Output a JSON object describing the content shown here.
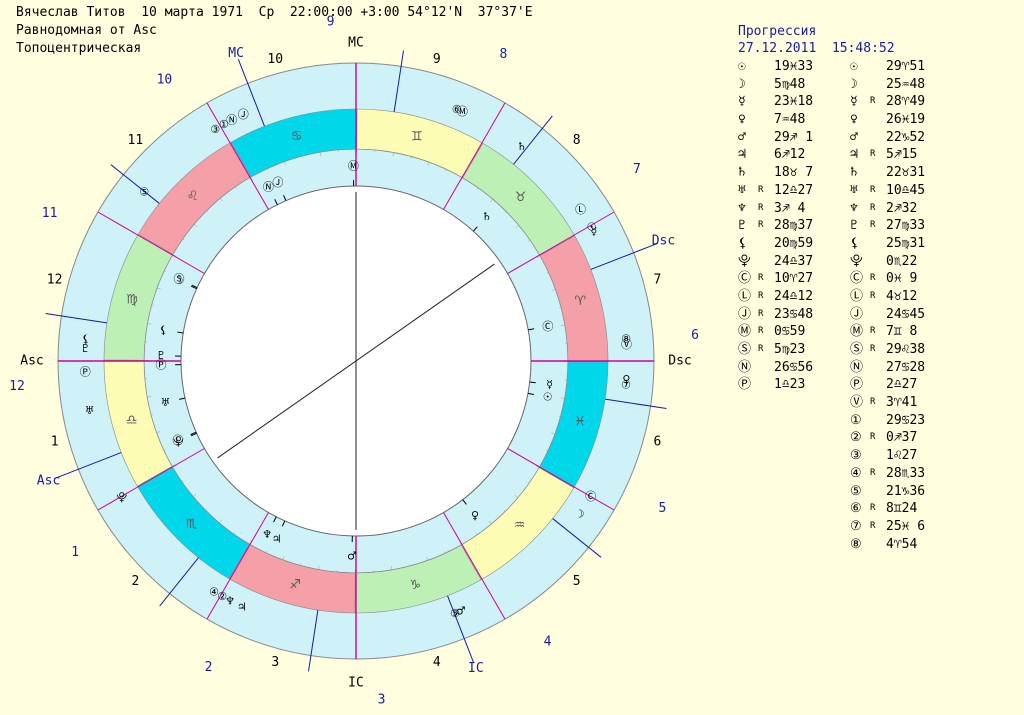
{
  "header": {
    "line1": "Вячеслав Титов  10 марта 1971  Ср  22:00:00 +3:00 54°12'N  37°37'E",
    "line2": "Равнодомная от Asc",
    "line3": "Топоцентрическая"
  },
  "chart_labels": {
    "asc": "Asc",
    "dsc": "Dsc",
    "mc": "MC",
    "ic": "IC",
    "inner_houses": [
      "1",
      "2",
      "3",
      "4",
      "5",
      "6",
      "7",
      "8",
      "9",
      "10",
      "11",
      "12"
    ],
    "outer_houses": [
      "1",
      "2",
      "3",
      "4",
      "5",
      "6",
      "7",
      "8",
      "9",
      "10",
      "11",
      "12"
    ]
  },
  "colors": {
    "background": "#ffffe0",
    "wheel_fill": "#cef2f8",
    "fire": "#f5a0a8",
    "earth": "#bdf0b4",
    "air": "#fcfcb4",
    "water": "#00d7ea",
    "house_line_inner": "#d000a0",
    "house_line_outer": "#1818a8"
  },
  "zodiac": [
    {
      "sign": "♈",
      "element": "fire"
    },
    {
      "sign": "♉",
      "element": "earth"
    },
    {
      "sign": "♊",
      "element": "air"
    },
    {
      "sign": "♋",
      "element": "water"
    },
    {
      "sign": "♌",
      "element": "fire"
    },
    {
      "sign": "♍",
      "element": "earth"
    },
    {
      "sign": "♎",
      "element": "air"
    },
    {
      "sign": "♏",
      "element": "water"
    },
    {
      "sign": "♐",
      "element": "fire"
    },
    {
      "sign": "♑",
      "element": "earth"
    },
    {
      "sign": "♒",
      "element": "air"
    },
    {
      "sign": "♓",
      "element": "water"
    }
  ],
  "natal_table": [
    {
      "planet": "☉",
      "retro": "",
      "pos": "19♓33"
    },
    {
      "planet": "☽",
      "retro": "",
      "pos": "5♍48"
    },
    {
      "planet": "☿",
      "retro": "",
      "pos": "23♓18"
    },
    {
      "planet": "♀",
      "retro": "",
      "pos": "7♒48"
    },
    {
      "planet": "♂",
      "retro": "",
      "pos": "29♐ 1"
    },
    {
      "planet": "♃",
      "retro": "",
      "pos": "6♐12"
    },
    {
      "planet": "♄",
      "retro": "",
      "pos": "18♉ 7"
    },
    {
      "planet": "♅",
      "retro": "R",
      "pos": "12♎27"
    },
    {
      "planet": "♆",
      "retro": "R",
      "pos": "3♐ 4"
    },
    {
      "planet": "♇",
      "retro": "R",
      "pos": "28♍37"
    },
    {
      "planet": "⚸",
      "retro": "",
      "pos": "20♍59"
    },
    {
      "planet": "⯓",
      "retro": "",
      "pos": "24♎37"
    },
    {
      "planet": "Ⓒ",
      "retro": "R",
      "pos": "10♈27"
    },
    {
      "planet": "Ⓛ",
      "retro": "R",
      "pos": "24♎12"
    },
    {
      "planet": "Ⓙ",
      "retro": "R",
      "pos": "23♋48"
    },
    {
      "planet": "Ⓜ",
      "retro": "R",
      "pos": "0♋59"
    },
    {
      "planet": "Ⓢ",
      "retro": "R",
      "pos": "5♍23"
    },
    {
      "planet": "Ⓝ",
      "retro": "",
      "pos": "26♋56"
    },
    {
      "planet": "Ⓟ",
      "retro": "",
      "pos": "1♎23"
    }
  ],
  "progression": {
    "title": "Прогрессия",
    "date": "27.12.2011",
    "time": "15:48:52",
    "table": [
      {
        "planet": "☉",
        "retro": "",
        "pos": "29♈51"
      },
      {
        "planet": "☽",
        "retro": "",
        "pos": "25♒48"
      },
      {
        "planet": "☿",
        "retro": "R",
        "pos": "28♈49"
      },
      {
        "planet": "♀",
        "retro": "",
        "pos": "26♓19"
      },
      {
        "planet": "♂",
        "retro": "",
        "pos": "22♑52"
      },
      {
        "planet": "♃",
        "retro": "R",
        "pos": "5♐15"
      },
      {
        "planet": "♄",
        "retro": "",
        "pos": "22♉31"
      },
      {
        "planet": "♅",
        "retro": "R",
        "pos": "10♎45"
      },
      {
        "planet": "♆",
        "retro": "R",
        "pos": "2♐32"
      },
      {
        "planet": "♇",
        "retro": "R",
        "pos": "27♍33"
      },
      {
        "planet": "⚸",
        "retro": "",
        "pos": "25♍31"
      },
      {
        "planet": "⯓",
        "retro": "",
        "pos": "0♏22"
      },
      {
        "planet": "Ⓒ",
        "retro": "R",
        "pos": "0♓ 9"
      },
      {
        "planet": "Ⓛ",
        "retro": "R",
        "pos": "4♉12"
      },
      {
        "planet": "Ⓙ",
        "retro": "",
        "pos": "24♋45"
      },
      {
        "planet": "Ⓜ",
        "retro": "R",
        "pos": "7♊ 8"
      },
      {
        "planet": "Ⓢ",
        "retro": "R",
        "pos": "29♌38"
      },
      {
        "planet": "Ⓝ",
        "retro": "",
        "pos": "27♋28"
      },
      {
        "planet": "Ⓟ",
        "retro": "",
        "pos": "2♎27"
      },
      {
        "planet": "Ⓥ",
        "retro": "R",
        "pos": "3♈41"
      },
      {
        "planet": "①",
        "retro": "",
        "pos": "29♋23"
      },
      {
        "planet": "②",
        "retro": "R",
        "pos": "0♐37"
      },
      {
        "planet": "③",
        "retro": "",
        "pos": "1♌27"
      },
      {
        "planet": "④",
        "retro": "R",
        "pos": "28♏33"
      },
      {
        "planet": "⑤",
        "retro": "",
        "pos": "21♑36"
      },
      {
        "planet": "⑥",
        "retro": "R",
        "pos": "8♊24"
      },
      {
        "planet": "⑦",
        "retro": "R",
        "pos": "25♓ 6"
      },
      {
        "planet": "⑧",
        "retro": "",
        "pos": "4♈54"
      }
    ]
  },
  "wheel_glyphs_natal": [
    {
      "g": "Ⓝ",
      "lon": 116.9
    },
    {
      "g": "Ⓙ",
      "lon": 113.8
    },
    {
      "g": "Ⓜ",
      "lon": 90.98
    },
    {
      "g": "♄",
      "lon": 48.1
    },
    {
      "g": "Ⓒ",
      "lon": 10.45
    },
    {
      "g": "☉",
      "lon": 349.55
    },
    {
      "g": "☿",
      "lon": 353.3
    },
    {
      "g": "♀",
      "lon": 307.8
    },
    {
      "g": "♂",
      "lon": 269.0
    },
    {
      "g": "♃",
      "lon": 246.2
    },
    {
      "g": "♆",
      "lon": 243.1
    },
    {
      "g": "☽",
      "lon": 155.8
    },
    {
      "g": "Ⓢ",
      "lon": 155.4
    },
    {
      "g": "⚸",
      "lon": 171.0
    },
    {
      "g": "Ⓟ",
      "lon": 181.4
    },
    {
      "g": "♅",
      "lon": 192.45
    },
    {
      "g": "Ⓛ",
      "lon": 204.2
    },
    {
      "g": "⯓",
      "lon": 204.6
    },
    {
      "g": "♇",
      "lon": 178.6
    }
  ],
  "wheel_glyphs_progressed": [
    {
      "g": "①",
      "lon": 119.4
    },
    {
      "g": "③",
      "lon": 121.5
    },
    {
      "g": "Ⓝ",
      "lon": 117.5
    },
    {
      "g": "Ⓙ",
      "lon": 114.8
    },
    {
      "g": "⑤",
      "lon": 141.6
    },
    {
      "g": "♇",
      "lon": 177.6
    },
    {
      "g": "Ⓟ",
      "lon": 182.5
    },
    {
      "g": "⚸",
      "lon": 175.5
    },
    {
      "g": "♅",
      "lon": 190.7
    },
    {
      "g": "⯓",
      "lon": 210.4
    },
    {
      "g": "④",
      "lon": 238.6
    },
    {
      "g": "②",
      "lon": 240.6
    },
    {
      "g": "♆",
      "lon": 242.5
    },
    {
      "g": "♃",
      "lon": 245.3
    },
    {
      "g": "⑤",
      "lon": 291.6
    },
    {
      "g": "♂",
      "lon": 292.9
    },
    {
      "g": "☽",
      "lon": 325.8
    },
    {
      "g": "Ⓒ",
      "lon": 330.2
    },
    {
      "g": "♀",
      "lon": 356.3
    },
    {
      "g": "⑦",
      "lon": 355.1
    },
    {
      "g": "Ⓥ",
      "lon": 3.7
    },
    {
      "g": "⑧",
      "lon": 4.9
    },
    {
      "g": "☉",
      "lon": 29.85
    },
    {
      "g": "☿",
      "lon": 28.8
    },
    {
      "g": "Ⓛ",
      "lon": 34.2
    },
    {
      "g": "♄",
      "lon": 52.5
    },
    {
      "g": "⑥",
      "lon": 68.4
    },
    {
      "g": "Ⓜ",
      "lon": 67.1
    }
  ]
}
